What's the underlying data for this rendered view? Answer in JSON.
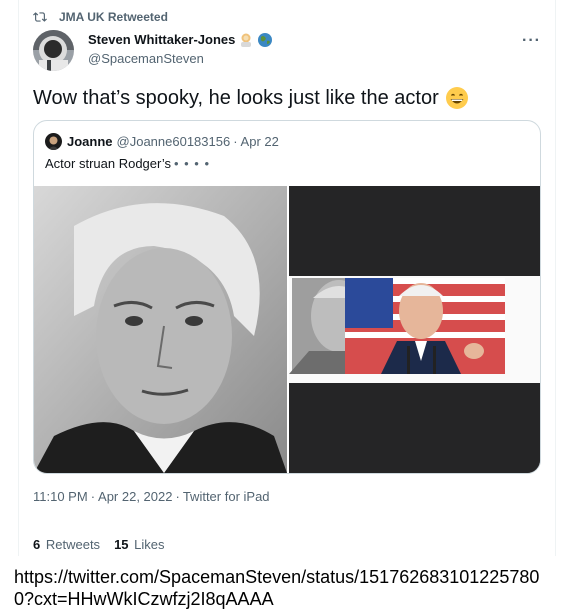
{
  "retweet": {
    "label": "JMA UK Retweeted"
  },
  "author": {
    "name": "Steven Whittaker-Jones",
    "handle": "@SpacemanSteven"
  },
  "tweet": {
    "text": "Wow that’s spooky, he looks just like the actor"
  },
  "quote": {
    "name": "Joanne",
    "handle": "@Joanne60183156",
    "separator": "·",
    "date": "Apr 22",
    "text": "Actor struan Rodger’s",
    "trailing": "• • • •"
  },
  "meta": {
    "time": "11:10 PM",
    "separator": "·",
    "date": "Apr 22, 2022",
    "source": "Twitter for iPad"
  },
  "stats": {
    "retweets_count": "6",
    "retweets_label": "Retweets",
    "likes_count": "15",
    "likes_label": "Likes"
  },
  "caption": "https://twitter.com/SpacemanSteven/status/1517626831012257800?cxt=HHwWkICzwfzj2I8qAAAA",
  "colors": {
    "muted": "#536471",
    "border": "#cfd9de",
    "text": "#0f1419",
    "dark_panel": "#252526"
  },
  "icons": [
    "retweet-icon",
    "more-icon",
    "grin-emoji-icon",
    "astronaut-emoji-icon",
    "globe-emoji-icon"
  ]
}
